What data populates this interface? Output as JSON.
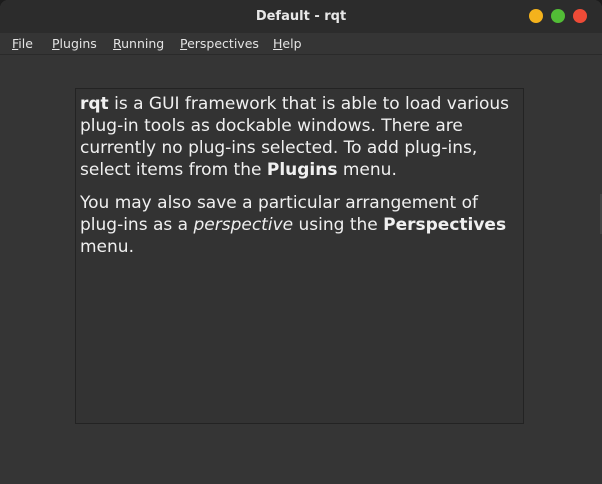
{
  "window": {
    "title": "Default - rqt",
    "buttons": [
      "minimize-icon",
      "maximize-icon",
      "close-icon"
    ],
    "colors": {
      "minimize": "#f4b21c",
      "maximize": "#52bd36",
      "close": "#ee4b37"
    }
  },
  "menubar": {
    "items": [
      {
        "mnemonic": "F",
        "rest": "ile"
      },
      {
        "mnemonic": "P",
        "rest": "lugins"
      },
      {
        "mnemonic": "R",
        "rest": "unning"
      },
      {
        "mnemonic": "P",
        "rest": "erspectives"
      },
      {
        "mnemonic": "H",
        "rest": "elp"
      }
    ]
  },
  "welcome": {
    "p1_bold_app": "rqt",
    "p1_text_a": " is a GUI framework that is able to load various plug-in tools as dockable windows. There are currently no plug-ins selected. To add plug-ins, select items from the ",
    "p1_bold_menu": "Plugins",
    "p1_text_b": " menu.",
    "p2_text_a": "You may also save a particular arrangement of plug-ins as a ",
    "p2_italic": "perspective",
    "p2_text_b": " using the ",
    "p2_bold_menu": "Perspectives",
    "p2_text_c": " menu."
  }
}
